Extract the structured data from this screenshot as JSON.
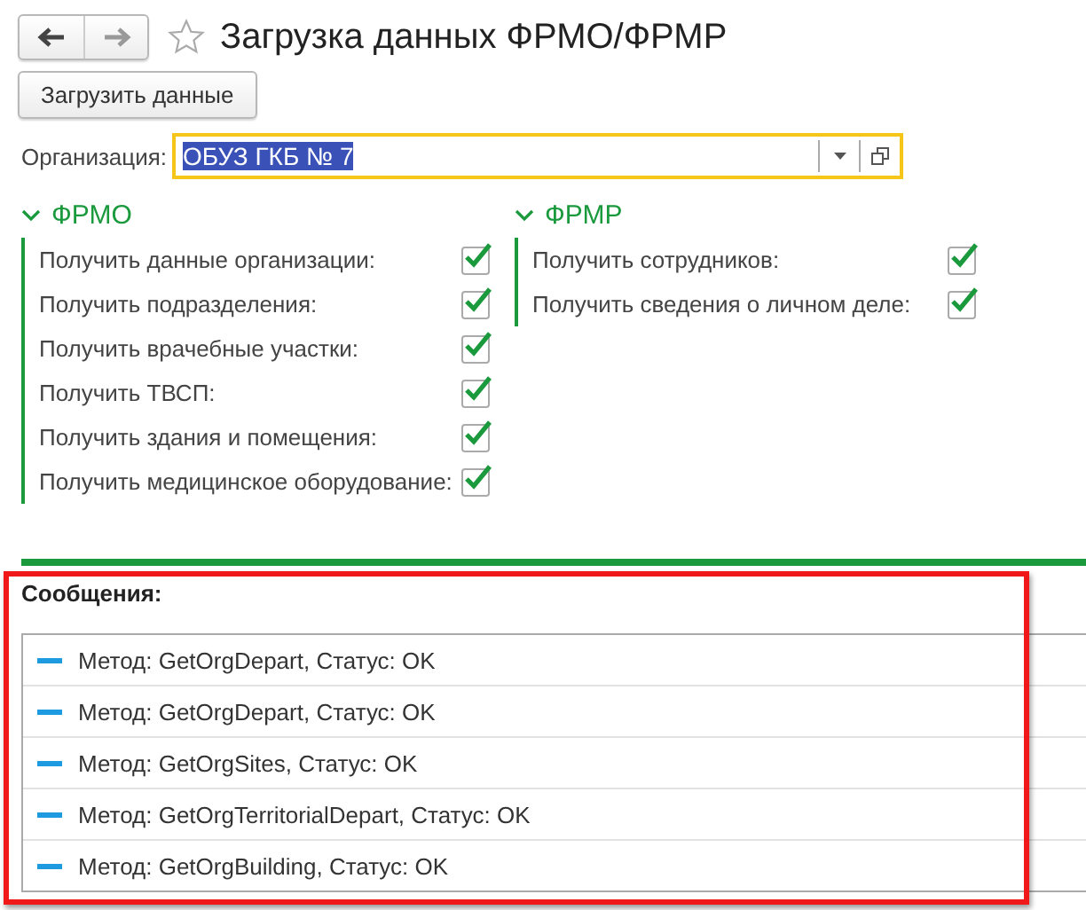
{
  "header": {
    "nav_buttons": [
      {
        "kind": "back",
        "disabled": false
      },
      {
        "kind": "forward",
        "disabled": true
      }
    ],
    "favorite": false,
    "title": "Загрузка данных ФРМО/ФРМР"
  },
  "load_button": "Загрузить данные",
  "organization": {
    "label": "Организация:",
    "value": "ОБУЗ ГКБ № 7",
    "focused": true,
    "value_selected": true
  },
  "groups": [
    {
      "title": "ФРМО",
      "expanded": true,
      "options": [
        {
          "label": "Получить данные организации:",
          "checked": true
        },
        {
          "label": "Получить подразделения:",
          "checked": true
        },
        {
          "label": "Получить врачебные участки:",
          "checked": true
        },
        {
          "label": "Получить ТВСП:",
          "checked": true
        },
        {
          "label": "Получить здания и помещения:",
          "checked": true
        },
        {
          "label": "Получить медицинское оборудование:",
          "checked": true
        }
      ]
    },
    {
      "title": "ФРМР",
      "expanded": true,
      "options": [
        {
          "label": "Получить сотрудников:",
          "checked": true
        },
        {
          "label": "Получить сведения о личном деле:",
          "checked": true
        }
      ]
    }
  ],
  "messages": {
    "title": "Сообщения:",
    "highlighted": true,
    "items": [
      "Метод: GetOrgDepart, Статус: OK",
      "Метод: GetOrgDepart, Статус: OK",
      "Метод: GetOrgSites, Статус: OK",
      "Метод: GetOrgTerritorialDepart, Статус: OK",
      "Метод: GetOrgBuilding, Статус: OK"
    ]
  }
}
